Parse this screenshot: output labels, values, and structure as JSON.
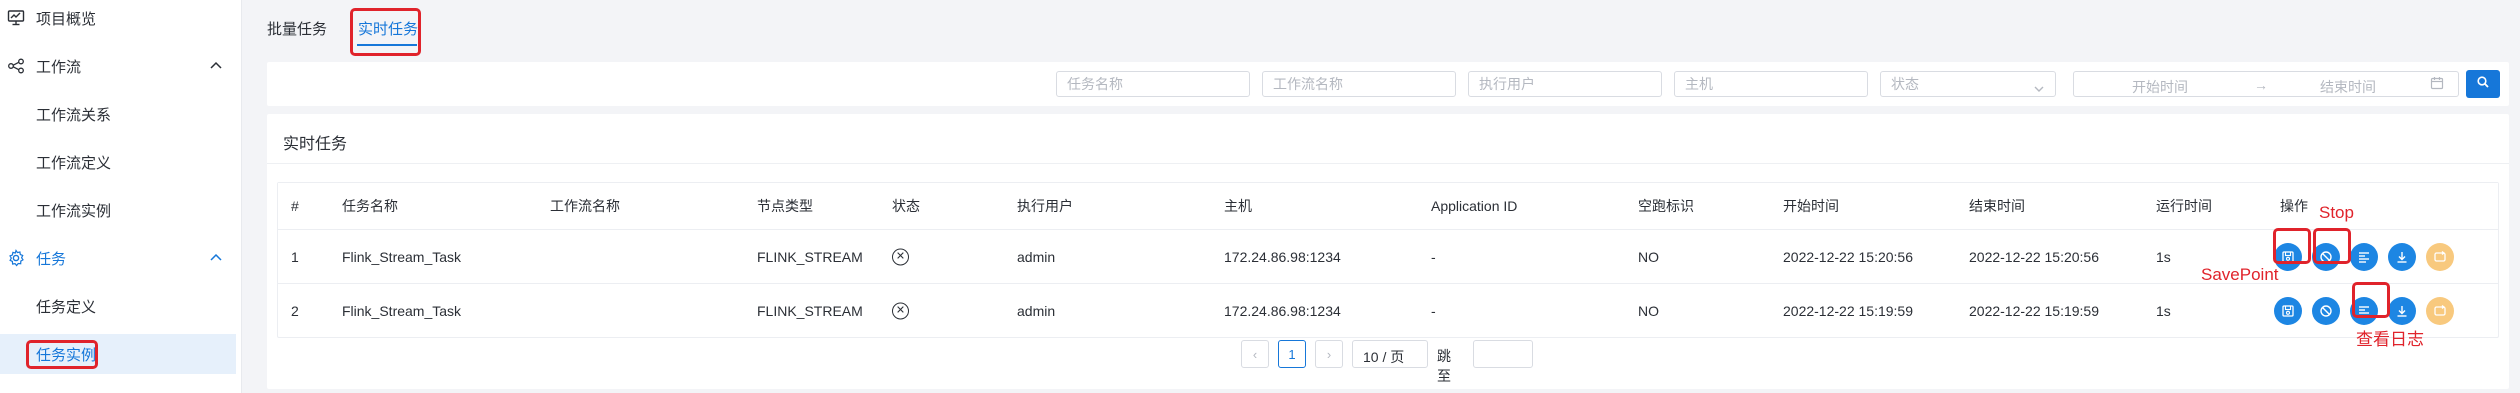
{
  "sidebar": {
    "items": [
      {
        "label": "项目概览",
        "icon": "monitor-chart-icon"
      },
      {
        "label": "工作流",
        "icon": "workflow-icon"
      },
      {
        "label": "工作流关系"
      },
      {
        "label": "工作流定义"
      },
      {
        "label": "工作流实例"
      },
      {
        "label": "任务",
        "icon": "gear-icon"
      },
      {
        "label": "任务定义"
      },
      {
        "label": "任务实例"
      }
    ]
  },
  "tabs": [
    {
      "label": "批量任务"
    },
    {
      "label": "实时任务"
    }
  ],
  "filters": {
    "task_name_placeholder": "任务名称",
    "workflow_name_placeholder": "工作流名称",
    "executor_placeholder": "执行用户",
    "host_placeholder": "主机",
    "state_placeholder": "状态",
    "start_time_placeholder": "开始时间",
    "end_time_placeholder": "结束时间",
    "range_arrow": "→"
  },
  "panel": {
    "title": "实时任务"
  },
  "table": {
    "headers": [
      "#",
      "任务名称",
      "工作流名称",
      "节点类型",
      "状态",
      "执行用户",
      "主机",
      "Application ID",
      "空跑标识",
      "开始时间",
      "结束时间",
      "运行时间",
      "操作"
    ],
    "rows": [
      {
        "index": "1",
        "task_name": "Flink_Stream_Task",
        "workflow_name": "",
        "node_type": "FLINK_STREAM",
        "state": "✕",
        "executor": "admin",
        "host": "172.24.86.98:1234",
        "app_id": "-",
        "dry_run": "NO",
        "start_time": "2022-12-22 15:20:56",
        "end_time": "2022-12-22 15:20:56",
        "duration": "1s"
      },
      {
        "index": "2",
        "task_name": "Flink_Stream_Task",
        "workflow_name": "",
        "node_type": "FLINK_STREAM",
        "state": "✕",
        "executor": "admin",
        "host": "172.24.86.98:1234",
        "app_id": "-",
        "dry_run": "NO",
        "start_time": "2022-12-22 15:19:59",
        "end_time": "2022-12-22 15:19:59",
        "duration": "1s"
      }
    ]
  },
  "annotations": {
    "stop": "Stop",
    "savepoint": "SavePoint",
    "view_log": "查看日志"
  },
  "pagination": {
    "prev": "‹",
    "current": "1",
    "next": "›",
    "page_size": "10 / 页",
    "jump_label": "跳至"
  },
  "colors": {
    "accent": "#1677d9",
    "action_button": "#1d86e3",
    "disabled_action": "#f8c97e",
    "annotation": "#e0232b"
  }
}
